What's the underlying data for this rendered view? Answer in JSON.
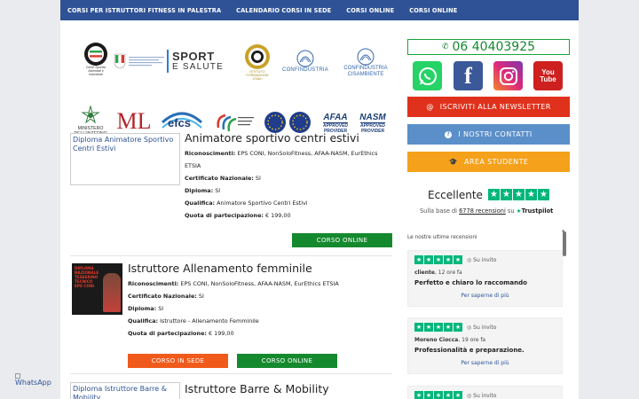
{
  "nav": {
    "items": [
      {
        "label": "CORSI PER ISTRUTTORI FITNESS IN PALESTRA"
      },
      {
        "label": "CALENDARIO CORSI IN SEDE"
      },
      {
        "label": "CORSI ONLINE"
      },
      {
        "label": "CORSI ONLINE"
      }
    ]
  },
  "logos": {
    "csen": "Centri Sportivi\nAziendali e Industriali",
    "sport": "SPORT",
    "salute": "E SALUTE",
    "istituto": "ISTITUTO\nFORMAZIONE\nCSAIn",
    "confindustria": "CONFINDUSTRIA",
    "confindustria_amb": "CONFINDUSTRIA\nCISAMBIENTE",
    "ministero": "MINISTERO\nDELL'INTERNO",
    "efcs": "efcs",
    "afaa": "AFAA",
    "afaa_sub": "APPROVED\nPROVIDER",
    "nasm": "NASM",
    "nasm_sub": "APPROVED\nPROVIDER"
  },
  "courses": [
    {
      "img_alt": "Diploma Animatore Sportivo Centri Estivi",
      "title": "Animatore sportivo centri estivi",
      "riconoscimenti_label": "Riconoscimenti:",
      "riconoscimenti": "EPS CONI, NonSoloFitness, AFAA-NASM, EurEthics",
      "riconoscimenti_cont": "ETSIA",
      "certificato_label": "Certificato Nazionale:",
      "certificato": "SI",
      "diploma_label": "Diploma:",
      "diploma": "SI",
      "qualifica_label": "Qualifica:",
      "qualifica": "Animatore Sportivo Centri Estivi",
      "quota_label": "Quota di partecipazione:",
      "quota": "€ 199,00",
      "btn_online": "CORSO ONLINE"
    },
    {
      "poster_text": "DIPLOMA NAZIONALE TESSERINO TECNICO EPS CONI",
      "title": "Istruttore Allenamento femminile",
      "riconoscimenti_label": "Riconoscimenti:",
      "riconoscimenti": "EPS CONI, NonSoloFitness, AFAA-NASM, EurEthics ETSIA",
      "certificato_label": "Certificato Nazionale:",
      "certificato": "SI",
      "diploma_label": "Diploma:",
      "diploma": "SI",
      "qualifica_label": "Qualifica:",
      "qualifica": "Istruttore - Allenamento Femminile",
      "quota_label": "Quota di partecipazione:",
      "quota": "€ 199,00",
      "btn_sede": "CORSO IN SEDE",
      "btn_online": "CORSO ONLINE"
    },
    {
      "img_alt": "Diploma Istruttore Barre & Mobility",
      "title": "Istruttore Barre & Mobility"
    }
  ],
  "sidebar": {
    "phone": "06 40403925",
    "newsletter": "ISCRIVITI ALLA NEWSLETTER",
    "contatti": "I NOSTRI CONTATTI",
    "area": "AREA STUDENTE",
    "social": [
      {
        "name": "whatsapp",
        "color": "#25d366"
      },
      {
        "name": "facebook",
        "color": "#3b5998"
      },
      {
        "name": "instagram",
        "color": "#c13584"
      },
      {
        "name": "youtube",
        "color": "#cd201f"
      }
    ],
    "youtube_text": "You\nTube",
    "colors": {
      "newsletter": "#e0311c",
      "contatti": "#5b8fc9",
      "area": "#f5a11b",
      "phone": "#15892e"
    }
  },
  "trustpilot": {
    "rating_text": "Eccellente",
    "base_prefix": "Sulla base di",
    "count": "6778 recensioni",
    "base_suffix": "su",
    "brand": "Trustpilot",
    "latest_label": "Le nostre ultime recensioni",
    "reviews": [
      {
        "invited": "Su invito",
        "author": "cliente",
        "time": ", 12 ore fa",
        "text": "Perfetto e chiaro lo raccomando",
        "more": "Per saperne di più"
      },
      {
        "invited": "Su invito",
        "author": "Moreno Ciocca",
        "time": ", 19 ore fa",
        "text": "Professionalità e preparazione.",
        "more": "Per saperne di più"
      },
      {
        "invited": "Su invito"
      }
    ]
  },
  "floating": {
    "whatsapp_alt": "WhatsApp"
  }
}
